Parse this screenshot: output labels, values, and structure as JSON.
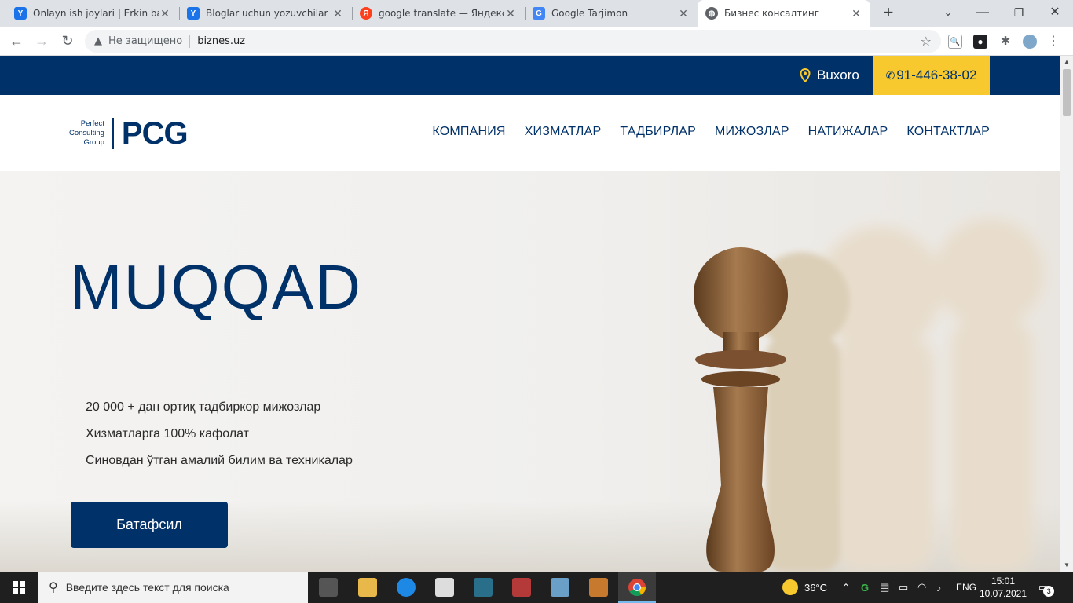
{
  "browser": {
    "tabs": [
      {
        "title": "Onlayn ish joylari | Erkin band",
        "favicon": "yandex-jobs-icon",
        "color": "#1a73e8"
      },
      {
        "title": "Bloglar uchun yozuvchilar / P",
        "favicon": "yandex-jobs-icon",
        "color": "#1a73e8"
      },
      {
        "title": "google translate — Яндекс: н",
        "favicon": "yandex-icon",
        "color": "#fc3f1d"
      },
      {
        "title": "Google Tarjimon",
        "favicon": "google-translate-icon",
        "color": "#4285f4"
      },
      {
        "title": "Бизнес консалтинг",
        "favicon": "globe-icon",
        "color": "#5f6368"
      }
    ],
    "security_label": "Не защищено",
    "url": "biznes.uz"
  },
  "site": {
    "city": "Buxoro",
    "phone": "91-446-38-02",
    "logo": {
      "line1": "Perfect",
      "line2": "Consulting",
      "line3": "Group",
      "mark": "PCG"
    },
    "menu": [
      "КОМПАНИЯ",
      "ХИЗМАТЛАР",
      "ТАДБИРЛАР",
      "МИЖОЗЛАР",
      "НАТИЖАЛАР",
      "КОНТАКТЛАР"
    ],
    "hero": {
      "title": "MUQQAD",
      "features": [
        "20 000 + дан ортиқ тадбиркор мижозлар",
        "Хизматларга 100% кафолат",
        "Синовдан ўтган амалий билим ва техникалар"
      ],
      "button": "Батафсил"
    },
    "colors": {
      "primary": "#003169",
      "accent": "#f7c92f"
    }
  },
  "taskbar": {
    "search_placeholder": "Введите здесь текст для поиска",
    "weather": "36°C",
    "lang": "ENG",
    "time": "15:01",
    "date": "10.07.2021",
    "notifications": "3"
  }
}
